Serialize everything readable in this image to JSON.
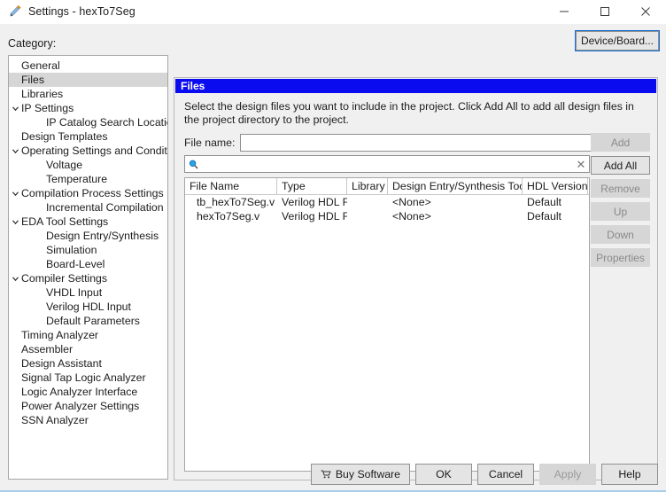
{
  "window": {
    "title": "Settings - hexTo7Seg",
    "icon": "pencil-settings-icon",
    "controls": {
      "minimize": "minimize-icon",
      "maximize": "maximize-icon",
      "close": "close-icon"
    }
  },
  "sidebar": {
    "label": "Category:",
    "items": [
      {
        "label": "General",
        "level": 0,
        "expandable": false,
        "selected": false
      },
      {
        "label": "Files",
        "level": 0,
        "expandable": false,
        "selected": true
      },
      {
        "label": "Libraries",
        "level": 0,
        "expandable": false,
        "selected": false
      },
      {
        "label": "IP Settings",
        "level": 0,
        "expandable": true,
        "selected": false
      },
      {
        "label": "IP Catalog Search Locations",
        "level": 1,
        "expandable": false,
        "selected": false
      },
      {
        "label": "Design Templates",
        "level": 0,
        "expandable": false,
        "selected": false
      },
      {
        "label": "Operating Settings and Conditions",
        "level": 0,
        "expandable": true,
        "selected": false
      },
      {
        "label": "Voltage",
        "level": 1,
        "expandable": false,
        "selected": false
      },
      {
        "label": "Temperature",
        "level": 1,
        "expandable": false,
        "selected": false
      },
      {
        "label": "Compilation Process Settings",
        "level": 0,
        "expandable": true,
        "selected": false
      },
      {
        "label": "Incremental Compilation",
        "level": 1,
        "expandable": false,
        "selected": false
      },
      {
        "label": "EDA Tool Settings",
        "level": 0,
        "expandable": true,
        "selected": false
      },
      {
        "label": "Design Entry/Synthesis",
        "level": 1,
        "expandable": false,
        "selected": false
      },
      {
        "label": "Simulation",
        "level": 1,
        "expandable": false,
        "selected": false
      },
      {
        "label": "Board-Level",
        "level": 1,
        "expandable": false,
        "selected": false
      },
      {
        "label": "Compiler Settings",
        "level": 0,
        "expandable": true,
        "selected": false
      },
      {
        "label": "VHDL Input",
        "level": 1,
        "expandable": false,
        "selected": false
      },
      {
        "label": "Verilog HDL Input",
        "level": 1,
        "expandable": false,
        "selected": false
      },
      {
        "label": "Default Parameters",
        "level": 1,
        "expandable": false,
        "selected": false
      },
      {
        "label": "Timing Analyzer",
        "level": 0,
        "expandable": false,
        "selected": false
      },
      {
        "label": "Assembler",
        "level": 0,
        "expandable": false,
        "selected": false
      },
      {
        "label": "Design Assistant",
        "level": 0,
        "expandable": false,
        "selected": false
      },
      {
        "label": "Signal Tap Logic Analyzer",
        "level": 0,
        "expandable": false,
        "selected": false
      },
      {
        "label": "Logic Analyzer Interface",
        "level": 0,
        "expandable": false,
        "selected": false
      },
      {
        "label": "Power Analyzer Settings",
        "level": 0,
        "expandable": false,
        "selected": false
      },
      {
        "label": "SSN Analyzer",
        "level": 0,
        "expandable": false,
        "selected": false
      }
    ]
  },
  "header": {
    "device_board_button": "Device/Board..."
  },
  "panel": {
    "title": "Files",
    "description": "Select the design files you want to include in the project. Click Add All to add all design files in the project directory to the project.",
    "file_name_label": "File name:",
    "file_name_value": "",
    "file_name_placeholder": "",
    "browse_button": "...",
    "search_value": "",
    "search_placeholder": "",
    "search_icon": "search-icon",
    "clear_icon": "clear-icon"
  },
  "side_buttons": [
    {
      "label": "Add",
      "enabled": false
    },
    {
      "label": "Add All",
      "enabled": true
    },
    {
      "label": "Remove",
      "enabled": false
    },
    {
      "label": "Up",
      "enabled": false
    },
    {
      "label": "Down",
      "enabled": false
    },
    {
      "label": "Properties",
      "enabled": false
    }
  ],
  "table": {
    "columns": [
      "File Name",
      "Type",
      "Library",
      "Design Entry/Synthesis Tool",
      "HDL Version"
    ],
    "rows": [
      [
        "tb_hexTo7Seg.v",
        "Verilog HDL File",
        "",
        "<None>",
        "Default"
      ],
      [
        "hexTo7Seg.v",
        "Verilog HDL File",
        "",
        "<None>",
        "Default"
      ]
    ]
  },
  "footer": {
    "buttons": [
      {
        "label": "Buy Software",
        "enabled": true,
        "icon": "shopping-cart-icon"
      },
      {
        "label": "OK",
        "enabled": true,
        "icon": ""
      },
      {
        "label": "Cancel",
        "enabled": true,
        "icon": ""
      },
      {
        "label": "Apply",
        "enabled": false,
        "icon": ""
      },
      {
        "label": "Help",
        "enabled": true,
        "icon": ""
      }
    ]
  },
  "colors": {
    "panel_title_bg": "#0b0bf0",
    "focus_outline": "#1a6fd4",
    "selection_bg": "#d6d6d6",
    "window_bg": "#f0f0f0"
  }
}
